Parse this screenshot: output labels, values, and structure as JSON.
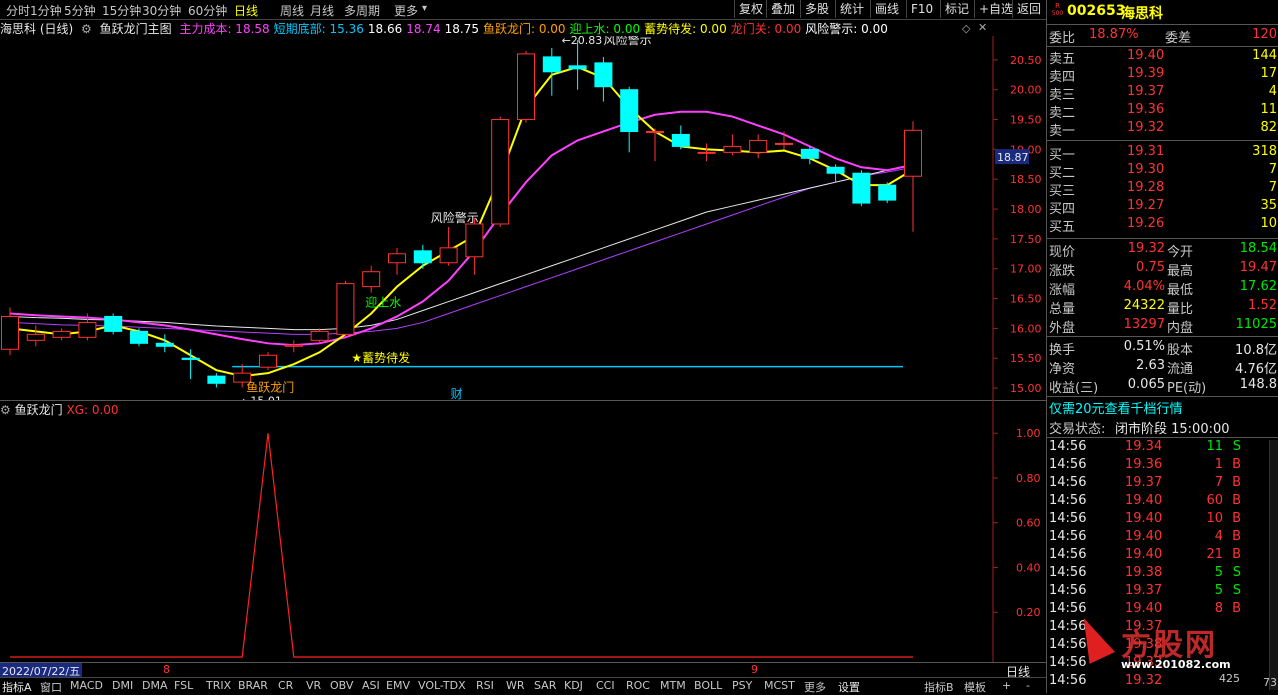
{
  "toolbar": {
    "left_items": [
      "分时",
      "1分钟",
      "5分钟",
      "15分钟",
      "30分钟",
      "60分钟",
      "日线",
      "周线",
      "月线",
      "多周期",
      "更多"
    ],
    "active": "日线",
    "right_items": [
      "复权",
      "叠加",
      "多股",
      "统计",
      "画线",
      "F10",
      "标记",
      "+自选",
      "返回"
    ]
  },
  "legend": {
    "stock": "海思科 (日线)",
    "indicator": "鱼跃龙门主图",
    "items": [
      {
        "label": "主力成本: 18.58",
        "color": "#ff40ff"
      },
      {
        "label": "短期底部: 15.36",
        "color": "#00c8ff"
      },
      {
        "label": "18.66",
        "color": "#ffffff"
      },
      {
        "label": "18.74",
        "color": "#ff40ff"
      },
      {
        "label": "18.75",
        "color": "#ffffff"
      },
      {
        "label": "鱼跃龙门: 0.00",
        "color": "#ffa000"
      },
      {
        "label": "迎上水: 0.00",
        "color": "#00ff00"
      },
      {
        "label": "蓄势待发: 0.00",
        "color": "#ffff00"
      },
      {
        "label": "龙门关: 0.00",
        "color": "#ff3232"
      },
      {
        "label": "风险警示: 0.00",
        "color": "#ffffff"
      }
    ]
  },
  "chart_data": [
    {
      "type": "candlestick",
      "title": "鱼跃龙门主图",
      "ylim": [
        14.8,
        20.9
      ],
      "yticks": [
        "20.50",
        "20.00",
        "19.50",
        "19.00",
        "18.50",
        "18.00",
        "17.50",
        "17.00",
        "16.50",
        "16.00",
        "15.50",
        "15.00"
      ],
      "current_price_label": "18.87",
      "candles": [
        {
          "o": 15.65,
          "c": 16.2,
          "h": 16.35,
          "l": 15.55
        },
        {
          "o": 15.8,
          "c": 15.9,
          "h": 16.05,
          "l": 15.7
        },
        {
          "o": 15.85,
          "c": 15.95,
          "h": 16.0,
          "l": 15.8
        },
        {
          "o": 15.85,
          "c": 16.1,
          "h": 16.25,
          "l": 15.8
        },
        {
          "o": 16.2,
          "c": 15.95,
          "h": 16.25,
          "l": 15.9
        },
        {
          "o": 15.95,
          "c": 15.75,
          "h": 16.0,
          "l": 15.7
        },
        {
          "o": 15.75,
          "c": 15.7,
          "h": 15.9,
          "l": 15.6
        },
        {
          "o": 15.5,
          "c": 15.48,
          "h": 15.65,
          "l": 15.15
        },
        {
          "o": 15.2,
          "c": 15.08,
          "h": 15.25,
          "l": 15.01
        },
        {
          "o": 15.1,
          "c": 15.25,
          "h": 15.4,
          "l": 15.01
        },
        {
          "o": 15.35,
          "c": 15.55,
          "h": 15.6,
          "l": 15.3
        },
        {
          "o": 15.7,
          "c": 15.72,
          "h": 15.8,
          "l": 15.6
        },
        {
          "o": 15.8,
          "c": 15.95,
          "h": 16.0,
          "l": 15.75
        },
        {
          "o": 15.9,
          "c": 16.75,
          "h": 16.8,
          "l": 15.85
        },
        {
          "o": 16.7,
          "c": 16.95,
          "h": 17.05,
          "l": 16.6
        },
        {
          "o": 17.1,
          "c": 17.25,
          "h": 17.35,
          "l": 16.9
        },
        {
          "o": 17.3,
          "c": 17.1,
          "h": 17.4,
          "l": 17.0
        },
        {
          "o": 17.1,
          "c": 17.35,
          "h": 17.7,
          "l": 17.05
        },
        {
          "o": 17.2,
          "c": 17.75,
          "h": 17.85,
          "l": 16.9
        },
        {
          "o": 17.75,
          "c": 19.5,
          "h": 19.55,
          "l": 17.7
        },
        {
          "o": 19.5,
          "c": 20.6,
          "h": 20.65,
          "l": 19.45
        },
        {
          "o": 20.55,
          "c": 20.3,
          "h": 20.7,
          "l": 19.9
        },
        {
          "o": 20.4,
          "c": 20.35,
          "h": 20.83,
          "l": 20.0
        },
        {
          "o": 20.45,
          "c": 20.05,
          "h": 20.55,
          "l": 19.8
        },
        {
          "o": 20.0,
          "c": 19.3,
          "h": 20.05,
          "l": 18.95
        },
        {
          "o": 19.3,
          "c": 19.3,
          "h": 19.35,
          "l": 18.8
        },
        {
          "o": 19.25,
          "c": 19.05,
          "h": 19.4,
          "l": 19.0
        },
        {
          "o": 18.95,
          "c": 18.95,
          "h": 19.1,
          "l": 18.8
        },
        {
          "o": 18.95,
          "c": 19.05,
          "h": 19.25,
          "l": 18.9
        },
        {
          "o": 18.95,
          "c": 19.15,
          "h": 19.25,
          "l": 18.85
        },
        {
          "o": 19.1,
          "c": 19.1,
          "h": 19.3,
          "l": 19.0
        },
        {
          "o": 19.0,
          "c": 18.85,
          "h": 19.05,
          "l": 18.75
        },
        {
          "o": 18.7,
          "c": 18.6,
          "h": 18.75,
          "l": 18.45
        },
        {
          "o": 18.6,
          "c": 18.1,
          "h": 18.65,
          "l": 18.05
        },
        {
          "o": 18.4,
          "c": 18.15,
          "h": 18.45,
          "l": 18.1
        },
        {
          "o": 18.55,
          "c": 19.32,
          "h": 19.47,
          "l": 17.62
        }
      ],
      "yellow_line": [
        16.0,
        15.95,
        15.9,
        15.95,
        16.05,
        15.95,
        15.8,
        15.55,
        15.3,
        15.2,
        15.25,
        15.4,
        15.6,
        15.9,
        16.25,
        16.7,
        17.05,
        17.3,
        17.55,
        18.55,
        19.7,
        20.25,
        20.38,
        20.2,
        19.7,
        19.3,
        19.05,
        19.0,
        18.98,
        18.95,
        18.98,
        18.85,
        18.65,
        18.4,
        18.4,
        18.66
      ],
      "magenta_line": [
        16.25,
        16.22,
        16.2,
        16.18,
        16.15,
        16.1,
        16.05,
        15.98,
        15.9,
        15.82,
        15.75,
        15.72,
        15.75,
        15.85,
        16.0,
        16.2,
        16.45,
        16.8,
        17.3,
        17.9,
        18.45,
        18.9,
        19.15,
        19.3,
        19.45,
        19.58,
        19.63,
        19.63,
        19.55,
        19.4,
        19.25,
        19.05,
        18.85,
        18.7,
        18.65,
        18.74
      ],
      "white_line": [
        16.2,
        16.18,
        16.17,
        16.15,
        16.14,
        16.12,
        16.1,
        16.07,
        16.04,
        16.02,
        16.0,
        15.98,
        15.98,
        16.0,
        16.05,
        16.15,
        16.3,
        16.45,
        16.6,
        16.75,
        16.9,
        17.05,
        17.2,
        17.35,
        17.5,
        17.65,
        17.8,
        17.95,
        18.05,
        18.15,
        18.25,
        18.35,
        18.45,
        18.55,
        18.65,
        18.75
      ],
      "purple_line": [
        16.1,
        16.08,
        16.06,
        16.05,
        16.04,
        16.02,
        16.0,
        15.98,
        15.96,
        15.94,
        15.92,
        15.9,
        15.9,
        15.92,
        15.95,
        16.0,
        16.1,
        16.25,
        16.4,
        16.55,
        16.7,
        16.85,
        17.0,
        17.15,
        17.3,
        17.45,
        17.6,
        17.75,
        17.9,
        18.05,
        18.2,
        18.35,
        18.45,
        18.55,
        18.62,
        18.7
      ],
      "support_level": 15.36,
      "annotations": {
        "high": "20.83",
        "low": "15.01",
        "risk1": "风险警示",
        "risk2": "风险警示",
        "up": "迎上水",
        "ready": "★蓄势待发",
        "dragon": "鱼跃龙门",
        "finance": "财"
      }
    },
    {
      "type": "line",
      "title": "鱼跃龙门",
      "series_label": "XG: 0.00",
      "ylim": [
        0,
        1.05
      ],
      "yticks": [
        "1.00",
        "0.80",
        "0.60",
        "0.40",
        "0.20"
      ],
      "values": [
        0,
        0,
        0,
        0,
        0,
        0,
        0,
        0,
        0,
        0,
        1,
        0,
        0,
        0,
        0,
        0,
        0,
        0,
        0,
        0,
        0,
        0,
        0,
        0,
        0,
        0,
        0,
        0,
        0,
        0,
        0,
        0,
        0,
        0,
        0,
        0
      ],
      "x_labels": {
        "date": "2022/07/22/五",
        "m8": "8",
        "m9": "9"
      },
      "period_label": "日线"
    }
  ],
  "panel": {
    "code": "002653",
    "name": "海思科",
    "badge_top": "R",
    "badge_bottom": "500",
    "weibi": {
      "label": "委比",
      "value": "18.87%",
      "label2": "委差",
      "value2": "120"
    },
    "asks": [
      {
        "label": "卖五",
        "price": "19.40",
        "vol": "144"
      },
      {
        "label": "卖四",
        "price": "19.39",
        "vol": "17"
      },
      {
        "label": "卖三",
        "price": "19.37",
        "vol": "4"
      },
      {
        "label": "卖二",
        "price": "19.36",
        "vol": "11"
      },
      {
        "label": "卖一",
        "price": "19.32",
        "vol": "82"
      }
    ],
    "bids": [
      {
        "label": "买一",
        "price": "19.31",
        "vol": "318"
      },
      {
        "label": "买二",
        "price": "19.30",
        "vol": "7"
      },
      {
        "label": "买三",
        "price": "19.28",
        "vol": "7"
      },
      {
        "label": "买四",
        "price": "19.27",
        "vol": "35"
      },
      {
        "label": "买五",
        "price": "19.26",
        "vol": "10"
      }
    ],
    "stats": [
      {
        "l1": "现价",
        "v1": "19.32",
        "c1": "red",
        "l2": "今开",
        "v2": "18.54",
        "c2": "green"
      },
      {
        "l1": "涨跌",
        "v1": "0.75",
        "c1": "red",
        "l2": "最高",
        "v2": "19.47",
        "c2": "red"
      },
      {
        "l1": "涨幅",
        "v1": "4.04%",
        "c1": "red",
        "l2": "最低",
        "v2": "17.62",
        "c2": "green"
      },
      {
        "l1": "总量",
        "v1": "24322",
        "c1": "yellow",
        "l2": "量比",
        "v2": "1.52",
        "c2": "red"
      },
      {
        "l1": "外盘",
        "v1": "13297",
        "c1": "red",
        "l2": "内盘",
        "v2": "11025",
        "c2": "green"
      }
    ],
    "fin": [
      {
        "l1": "换手",
        "v1": "0.51%",
        "l2": "股本",
        "v2": "10.8亿"
      },
      {
        "l1": "净资",
        "v1": "2.63",
        "l2": "流通",
        "v2": "4.76亿"
      },
      {
        "l1": "收益(三)",
        "v1": "0.065",
        "l2": "PE(动)",
        "v2": "148.8"
      }
    ],
    "promo": "仅需20元查看千档行情",
    "status_label": "交易状态:",
    "status_value": "闭市阶段 15:00:00",
    "trades": [
      {
        "t": "14:56",
        "p": "19.34",
        "v": "11",
        "s": "S"
      },
      {
        "t": "14:56",
        "p": "19.36",
        "v": "1",
        "s": "B"
      },
      {
        "t": "14:56",
        "p": "19.37",
        "v": "7",
        "s": "B"
      },
      {
        "t": "14:56",
        "p": "19.40",
        "v": "60",
        "s": "B"
      },
      {
        "t": "14:56",
        "p": "19.40",
        "v": "10",
        "s": "B"
      },
      {
        "t": "14:56",
        "p": "19.40",
        "v": "4",
        "s": "B"
      },
      {
        "t": "14:56",
        "p": "19.40",
        "v": "21",
        "s": "B"
      },
      {
        "t": "14:56",
        "p": "19.38",
        "v": "5",
        "s": "S"
      },
      {
        "t": "14:56",
        "p": "19.37",
        "v": "5",
        "s": "S"
      },
      {
        "t": "14:56",
        "p": "19.40",
        "v": "8",
        "s": "B"
      },
      {
        "t": "14:56",
        "p": "19.37",
        "v": "",
        "s": ""
      },
      {
        "t": "14:56",
        "p": "19.38",
        "v": "",
        "s": ""
      },
      {
        "t": "14:56",
        "p": "19.33",
        "v": "",
        "s": ""
      },
      {
        "t": "14:56",
        "p": "19.32",
        "v": "",
        "s": ""
      }
    ],
    "bottom_right_num": "73",
    "watermark_text": "方股网",
    "watermark_url": "www.201082.com",
    "watermark_num": "425"
  },
  "tabs": [
    "指标A",
    "窗口",
    "MACD",
    "DMI",
    "DMA",
    "FSL",
    "TRIX",
    "BRAR",
    "CR",
    "VR",
    "OBV",
    "ASI",
    "EMV",
    "VOL-TDX",
    "RSI",
    "WR",
    "SAR",
    "KDJ",
    "CCI",
    "ROC",
    "MTM",
    "BOLL",
    "PSY",
    "MCST",
    "更多",
    "设置"
  ],
  "tabs_right": [
    "指标B",
    "模板",
    "+",
    "-"
  ],
  "colors": {
    "up": "#ff3232",
    "down": "#00ffff",
    "yellow": "#ffff00",
    "magenta": "#ff40ff",
    "white": "#e8e8e8",
    "purple": "#b040ff",
    "support": "#00c8ff"
  }
}
